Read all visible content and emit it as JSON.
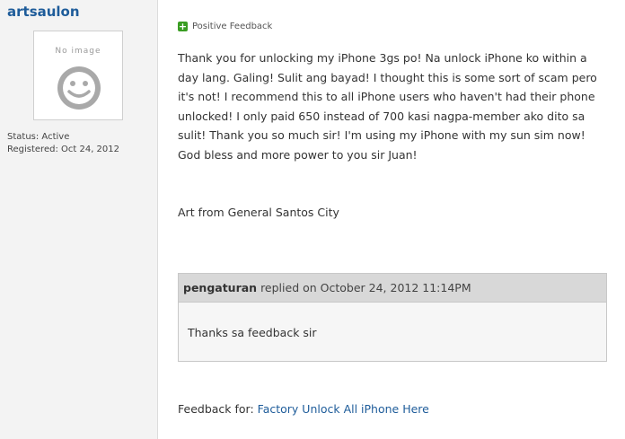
{
  "sidebar": {
    "username": "artsaulon",
    "avatar_text": "No image",
    "status": "Status: Active",
    "registered": "Registered: Oct 24, 2012"
  },
  "feedback": {
    "type_label": "Positive Feedback",
    "body": "Thank you for unlocking my iPhone 3gs po! Na unlock iPhone ko within a day lang. Galing! Sulit ang bayad! I thought this is some sort of scam pero it's not! I recommend this to all iPhone users who haven't had their phone unlocked! I only paid 650 instead of 700 kasi nagpa-member ako dito sa sulit! Thank you so much sir! I'm using my iPhone with my sun sim now! God bless and more power to you sir Juan!",
    "signature": "Art from General Santos City"
  },
  "reply": {
    "author": "pengaturan",
    "meta": " replied on October 24, 2012 11:14PM",
    "body": "Thanks sa feedback sir"
  },
  "feedback_for": {
    "label": "Feedback for: ",
    "link": "Factory Unlock All iPhone Here"
  },
  "colors": {
    "link": "#1e5c9a",
    "positive": "#3a9d23",
    "sidebar_bg": "#f3f3f3",
    "reply_header": "#d8d8d8"
  }
}
